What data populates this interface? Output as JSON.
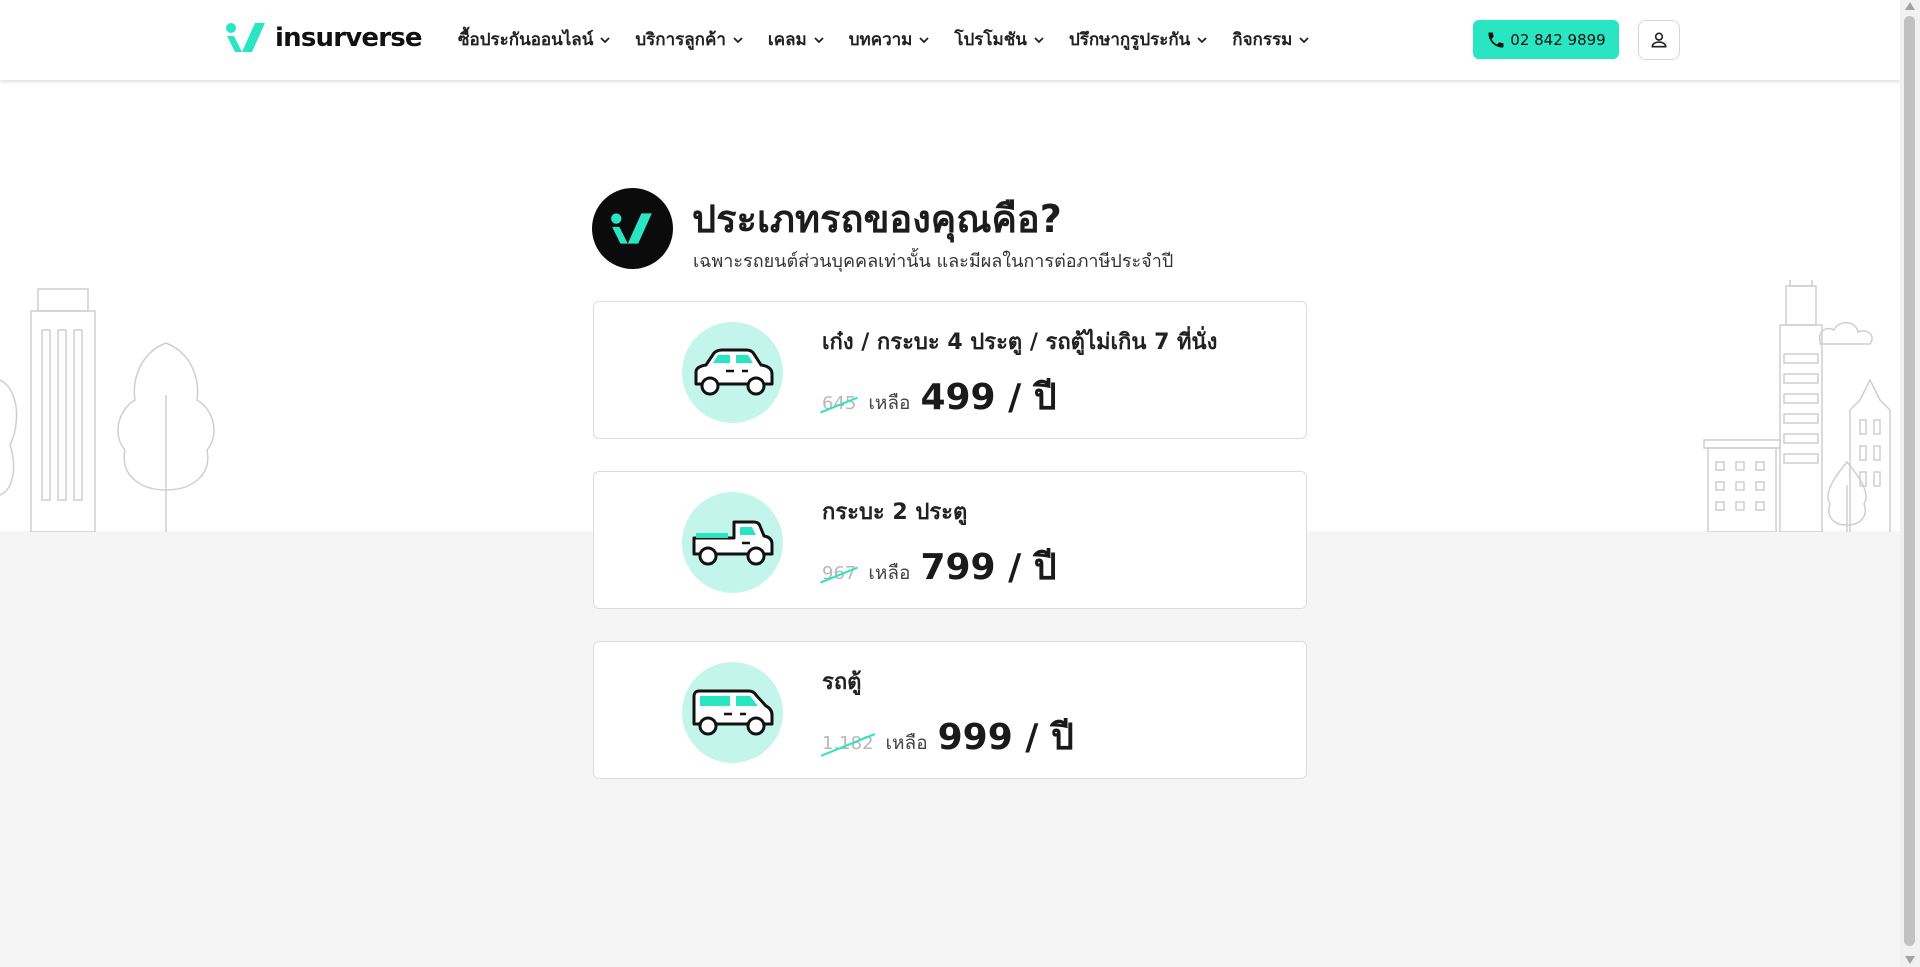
{
  "header": {
    "logo_text": "insurverse",
    "nav": [
      {
        "label": "ซื้อประกันออนไลน์"
      },
      {
        "label": "บริการลูกค้า"
      },
      {
        "label": "เคลม"
      },
      {
        "label": "บทความ"
      },
      {
        "label": "โปรโมชัน"
      },
      {
        "label": "ปรึกษากูรูประกัน"
      },
      {
        "label": "กิจกรรม"
      }
    ],
    "phone": "02 842 9899"
  },
  "main": {
    "title": "ประเภทรถของคุณคือ?",
    "subtitle": "เฉพาะรถยนต์ส่วนบุคคลเท่านั้น และมีผลในการต่อภาษีประจำปี",
    "options": [
      {
        "name": "เก๋ง / กระบะ 4 ประตู / รถตู้ไม่เกิน 7 ที่นั่ง",
        "old_price": "645",
        "remain_label": "เหลือ",
        "price": "499 / ปี"
      },
      {
        "name": "กระบะ 2 ประตู",
        "old_price": "967",
        "remain_label": "เหลือ",
        "price": "799 / ปี"
      },
      {
        "name": "รถตู้",
        "old_price": "1,182",
        "remain_label": "เหลือ",
        "price": "999 / ปี"
      }
    ]
  },
  "colors": {
    "accent": "#2ae5c1",
    "icon_bg": "#c3f5ea",
    "page_bg": "#f5f5f5"
  }
}
